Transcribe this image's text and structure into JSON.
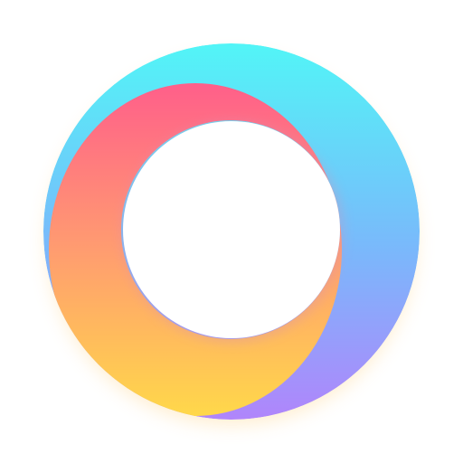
{
  "logo": {
    "name": "ring-logo-icon",
    "colors": {
      "background": "#ffffff",
      "cool_top": "#52f5f7",
      "cool_bottom": "#b085fb",
      "warm_top": "#ff5f8a",
      "warm_mid": "#ff9c70",
      "warm_bottom": "#ffd84a"
    }
  }
}
